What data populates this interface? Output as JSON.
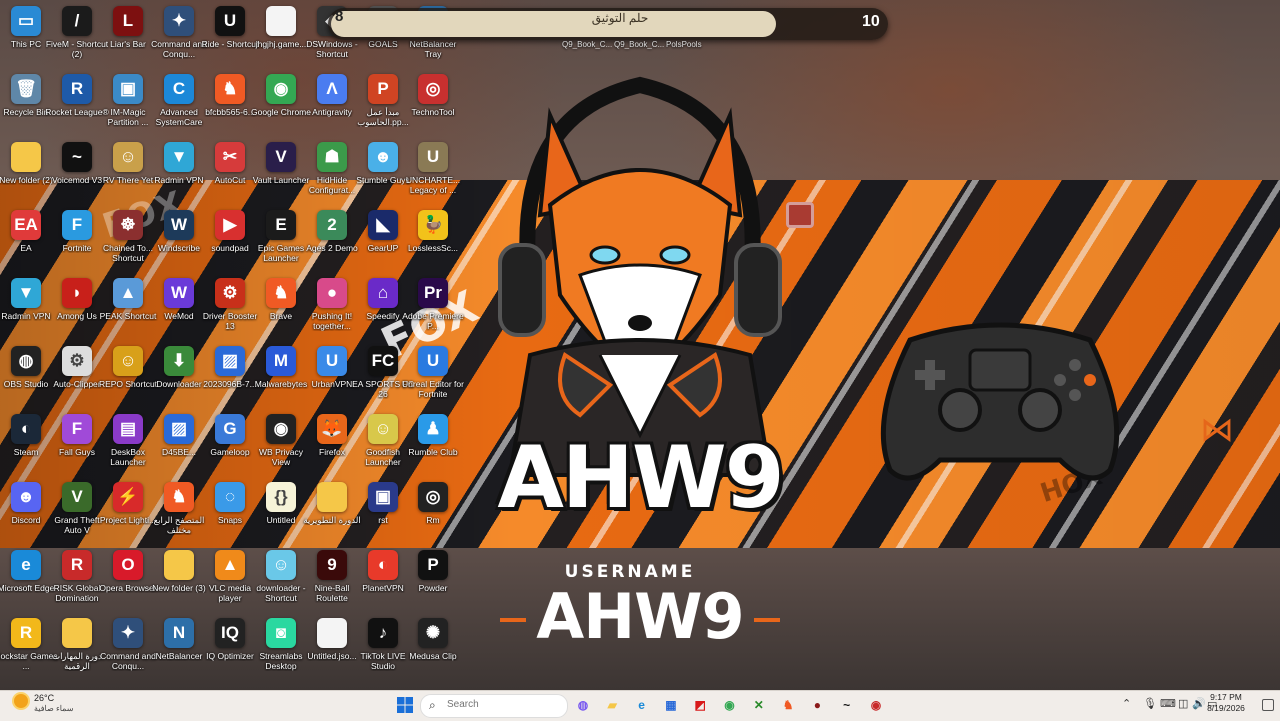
{
  "wallpaper": {
    "brand_text": "AHW9",
    "username_label": "USERNAME",
    "username_value": "AHW9",
    "watermark_left": "FOX",
    "watermark_mid": "FOX",
    "watermark_right": "HOX"
  },
  "widget": {
    "left_value": "8",
    "center_text": "حلم التوثيق",
    "right_value": "10",
    "sub_labels": [
      "Q9_Book_C...",
      "Q9_Book_C...",
      "PolsPools"
    ]
  },
  "desktop_icons": [
    {
      "label": "This PC",
      "icon": "computer-icon",
      "color": "#2a8ad4",
      "glyph": "▭"
    },
    {
      "label": "FiveM - Shortcut (2)",
      "icon": "fivem-icon",
      "color": "#1b1b1b",
      "glyph": "/"
    },
    {
      "label": "Liar's Bar",
      "icon": "liars-bar-icon",
      "color": "#7d1010",
      "glyph": "L"
    },
    {
      "label": "Command and Conqu...",
      "icon": "command-conquer-icon",
      "color": "#2f4f7a",
      "glyph": "✦"
    },
    {
      "label": "Ride - Shortcut",
      "icon": "unreal-icon",
      "color": "#111111",
      "glyph": "U"
    },
    {
      "label": "jhgjhj.game...",
      "icon": "file-icon",
      "color": "#f4f4f4",
      "glyph": ""
    },
    {
      "label": "DSWindows - Shortcut",
      "icon": "dswindows-icon",
      "color": "#333",
      "glyph": "◆"
    },
    {
      "label": "GOALS",
      "icon": "goals-icon",
      "color": "#555",
      "glyph": "G"
    },
    {
      "label": "NetBalancer Tray",
      "icon": "netbalancer-icon",
      "color": "#2d6fa8",
      "glyph": "N"
    },
    {
      "label": "Recycle Bin",
      "icon": "recycle-bin-icon",
      "color": "#5f87a8",
      "glyph": "🗑"
    },
    {
      "label": "Rocket League®",
      "icon": "rocket-league-icon",
      "color": "#1e5aa8",
      "glyph": "R"
    },
    {
      "label": "IM-Magic Partition ...",
      "icon": "partition-icon",
      "color": "#3b8ac7",
      "glyph": "▣"
    },
    {
      "label": "Advanced SystemCare",
      "icon": "systemcare-icon",
      "color": "#1c88d8",
      "glyph": "C"
    },
    {
      "label": "bfcbb565-6...",
      "icon": "brave-icon",
      "color": "#f05a24",
      "glyph": "♞"
    },
    {
      "label": "Google Chrome",
      "icon": "chrome-icon",
      "color": "#34a853",
      "glyph": "◉"
    },
    {
      "label": "Antigravity",
      "icon": "antigravity-icon",
      "color": "#4a7cf0",
      "glyph": "Λ"
    },
    {
      "label": "مبدأ عمل الحاسوب.pp...",
      "icon": "powerpoint-icon",
      "color": "#d04423",
      "glyph": "P"
    },
    {
      "label": "TechnoTool",
      "icon": "technotool-icon",
      "color": "#c8302f",
      "glyph": "◎"
    },
    {
      "label": "New folder (2)",
      "icon": "folder-icon",
      "color": "#f5c748",
      "glyph": ""
    },
    {
      "label": "Voicemod V3",
      "icon": "voicemod-icon",
      "color": "#111",
      "glyph": "~"
    },
    {
      "label": "RV There Yet",
      "icon": "rv-icon",
      "color": "#c9a04a",
      "glyph": "☺"
    },
    {
      "label": "Radmin VPN",
      "icon": "radmin-vpn-icon",
      "color": "#2fa7d6",
      "glyph": "▼"
    },
    {
      "label": "AutoCut",
      "icon": "autocut-icon",
      "color": "#d63b3b",
      "glyph": "✂"
    },
    {
      "label": "Vault Launcher",
      "icon": "vault-launcher-icon",
      "color": "#2a1e4a",
      "glyph": "V"
    },
    {
      "label": "HidHide Configurat...",
      "icon": "hidhide-icon",
      "color": "#3b9a4a",
      "glyph": "☗"
    },
    {
      "label": "Stumble Guys",
      "icon": "stumble-guys-icon",
      "color": "#4ab0e8",
      "glyph": "☻"
    },
    {
      "label": "UNCHARTE... Legacy of ...",
      "icon": "uncharted-icon",
      "color": "#8a7a55",
      "glyph": "U"
    },
    {
      "label": "EA",
      "icon": "ea-icon",
      "color": "#e03a3a",
      "glyph": "EA"
    },
    {
      "label": "Fortnite",
      "icon": "fortnite-icon",
      "color": "#2a9ae0",
      "glyph": "F"
    },
    {
      "label": "Chained To... Shortcut",
      "icon": "chained-icon",
      "color": "#8b2f2f",
      "glyph": "☸"
    },
    {
      "label": "Windscribe",
      "icon": "windscribe-icon",
      "color": "#1d3a5a",
      "glyph": "W"
    },
    {
      "label": "soundpad",
      "icon": "soundpad-icon",
      "color": "#d8302f",
      "glyph": "▶"
    },
    {
      "label": "Epic Games Launcher",
      "icon": "epic-games-icon",
      "color": "#1b1b1b",
      "glyph": "E"
    },
    {
      "label": "Ages 2 Demo",
      "icon": "ages-icon",
      "color": "#3b8a5a",
      "glyph": "2"
    },
    {
      "label": "GearUP",
      "icon": "gearup-icon",
      "color": "#1a2a6a",
      "glyph": "◣"
    },
    {
      "label": "LosslessSc...",
      "icon": "lossless-icon",
      "color": "#f2c21a",
      "glyph": "🦆"
    },
    {
      "label": "Radmin VPN",
      "icon": "radmin-vpn-icon",
      "color": "#2fa7d6",
      "glyph": "▼"
    },
    {
      "label": "Among Us",
      "icon": "among-us-icon",
      "color": "#c8201a",
      "glyph": "◗"
    },
    {
      "label": "PEAK Shortcut",
      "icon": "peak-icon",
      "color": "#5a9ad8",
      "glyph": "▲"
    },
    {
      "label": "WeMod",
      "icon": "wemod-icon",
      "color": "#6a3ad8",
      "glyph": "W"
    },
    {
      "label": "Driver Booster 13",
      "icon": "driver-booster-icon",
      "color": "#c8301a",
      "glyph": "⚙"
    },
    {
      "label": "Brave",
      "icon": "brave-icon",
      "color": "#f05a24",
      "glyph": "♞"
    },
    {
      "label": "Pushing It! together...",
      "icon": "pushing-icon",
      "color": "#d84a8a",
      "glyph": "●"
    },
    {
      "label": "Speedify",
      "icon": "speedify-icon",
      "color": "#6a2ac8",
      "glyph": "⌂"
    },
    {
      "label": "Adobe Premiere P...",
      "icon": "premiere-icon",
      "color": "#2a0a4a",
      "glyph": "Pr"
    },
    {
      "label": "OBS Studio",
      "icon": "obs-icon",
      "color": "#222",
      "glyph": "◍"
    },
    {
      "label": "Auto-Clipper",
      "icon": "auto-clipper-icon",
      "color": "#ddd",
      "glyph": "⚙"
    },
    {
      "label": "REPO Shortcut",
      "icon": "repo-icon",
      "color": "#d8a01a",
      "glyph": "☺"
    },
    {
      "label": "Downloader",
      "icon": "downloader-icon",
      "color": "#3a8a3a",
      "glyph": "⬇"
    },
    {
      "label": "2023096B-7...",
      "icon": "image-file-icon",
      "color": "#2a6ad8",
      "glyph": "▨"
    },
    {
      "label": "Malwarebytes",
      "icon": "malwarebytes-icon",
      "color": "#2a5ad8",
      "glyph": "M"
    },
    {
      "label": "UrbanVPN",
      "icon": "urbanvpn-icon",
      "color": "#3a8ae8",
      "glyph": "U"
    },
    {
      "label": "EA SPORTS FC 26",
      "icon": "fc26-icon",
      "color": "#111",
      "glyph": "FC"
    },
    {
      "label": "Unreal Editor for Fortnite",
      "icon": "unreal-editor-icon",
      "color": "#2a7ae0",
      "glyph": "U"
    },
    {
      "label": "Steam",
      "icon": "steam-icon",
      "color": "#1b2838",
      "glyph": "◐"
    },
    {
      "label": "Fall Guys",
      "icon": "fall-guys-icon",
      "color": "#a04ad8",
      "glyph": "F"
    },
    {
      "label": "DeskBox Launcher",
      "icon": "deskbox-icon",
      "color": "#8a3ac8",
      "glyph": "▤"
    },
    {
      "label": "D45BE...",
      "icon": "image-file-icon",
      "color": "#2a6ad8",
      "glyph": "▨"
    },
    {
      "label": "Gameloop",
      "icon": "gameloop-icon",
      "color": "#3a7ad8",
      "glyph": "G"
    },
    {
      "label": "WB Privacy View",
      "icon": "privacy-icon",
      "color": "#222",
      "glyph": "◉"
    },
    {
      "label": "Firefox",
      "icon": "firefox-icon",
      "color": "#e8661a",
      "glyph": "🦊"
    },
    {
      "label": "Goodfish Launcher",
      "icon": "goodfish-icon",
      "color": "#d8c84a",
      "glyph": "☺"
    },
    {
      "label": "Rumble Club",
      "icon": "rumble-club-icon",
      "color": "#2a9ae8",
      "glyph": "♟"
    },
    {
      "label": "Discord",
      "icon": "discord-icon",
      "color": "#5865f2",
      "glyph": "☻"
    },
    {
      "label": "Grand Theft Auto V",
      "icon": "gta5-icon",
      "color": "#3a6a2a",
      "glyph": "V"
    },
    {
      "label": "Project Lighti...",
      "icon": "project-icon",
      "color": "#d82a2a",
      "glyph": "⚡"
    },
    {
      "label": "المتصفح الرابع مختلف",
      "icon": "browser-icon",
      "color": "#f05a24",
      "glyph": "♞"
    },
    {
      "label": "Snaps",
      "icon": "snaps-icon",
      "color": "#3a9ae8",
      "glyph": "◌"
    },
    {
      "label": "Untitled",
      "icon": "code-file-icon",
      "color": "#f6f3d8",
      "glyph": "{}"
    },
    {
      "label": "الدورة التطويرية",
      "icon": "folder-icon",
      "color": "#f5c748",
      "glyph": ""
    },
    {
      "label": "rst",
      "icon": "rst-icon",
      "color": "#2a3a8a",
      "glyph": "▣"
    },
    {
      "label": "Rm",
      "icon": "rm-icon",
      "color": "#222",
      "glyph": "◎"
    },
    {
      "label": "Microsoft Edge",
      "icon": "edge-icon",
      "color": "#1a8ad8",
      "glyph": "e"
    },
    {
      "label": "RISK Global Domination",
      "icon": "risk-icon",
      "color": "#c82a2a",
      "glyph": "R"
    },
    {
      "label": "Opera Browser",
      "icon": "opera-icon",
      "color": "#d81a2a",
      "glyph": "O"
    },
    {
      "label": "New folder (3)",
      "icon": "folder-icon",
      "color": "#f5c748",
      "glyph": ""
    },
    {
      "label": "VLC media player",
      "icon": "vlc-icon",
      "color": "#f08a1a",
      "glyph": "▲"
    },
    {
      "label": "downloader - Shortcut",
      "icon": "downloader-anime-icon",
      "color": "#6ac8e8",
      "glyph": "☺"
    },
    {
      "label": "Nine-Ball Roulette",
      "icon": "nine-ball-icon",
      "color": "#3a0a0a",
      "glyph": "9"
    },
    {
      "label": "PlanetVPN",
      "icon": "planetvpn-icon",
      "color": "#e83a2a",
      "glyph": "◐"
    },
    {
      "label": "Powder",
      "icon": "powder-icon",
      "color": "#111",
      "glyph": "P"
    },
    {
      "label": "Rockstar Games ...",
      "icon": "rockstar-icon",
      "color": "#f2b81a",
      "glyph": "R"
    },
    {
      "label": "دورة المهارات الرقمية",
      "icon": "folder-icon",
      "color": "#f5c748",
      "glyph": ""
    },
    {
      "label": "Command and Conqu...",
      "icon": "command-conquer-icon",
      "color": "#2f4f7a",
      "glyph": "✦"
    },
    {
      "label": "NetBalancer",
      "icon": "netbalancer-icon",
      "color": "#2d6fa8",
      "glyph": "N"
    },
    {
      "label": "IQ Optimizer",
      "icon": "iq-optimizer-icon",
      "color": "#222",
      "glyph": "IQ"
    },
    {
      "label": "Streamlabs Desktop",
      "icon": "streamlabs-icon",
      "color": "#2ad8a0",
      "glyph": "◙"
    },
    {
      "label": "Untitled.jso...",
      "icon": "json-file-icon",
      "color": "#f4f4f4",
      "glyph": ""
    },
    {
      "label": "TikTok LIVE Studio",
      "icon": "tiktok-icon",
      "color": "#111",
      "glyph": "♪"
    },
    {
      "label": "Medusa Clip",
      "icon": "medusa-icon",
      "color": "#222",
      "glyph": "✺"
    }
  ],
  "taskbar": {
    "weather_temp": "26°C",
    "weather_desc": "سماء صافية",
    "search_placeholder": "Search",
    "clock_time": "9:17 PM",
    "clock_date": "8/19/2026",
    "pinned": [
      {
        "name": "copilot-icon",
        "color": "#7a5af0",
        "glyph": "◍"
      },
      {
        "name": "file-explorer-icon",
        "color": "#f5c748",
        "glyph": "▰"
      },
      {
        "name": "edge-icon",
        "color": "#1a8ad8",
        "glyph": "e"
      },
      {
        "name": "store-icon",
        "color": "#2a6ad8",
        "glyph": "▦"
      },
      {
        "name": "amd-icon",
        "color": "#d81a1a",
        "glyph": "◩"
      },
      {
        "name": "chrome-icon",
        "color": "#34a853",
        "glyph": "◉"
      },
      {
        "name": "xbox-icon",
        "color": "#2a8a2a",
        "glyph": "✕"
      },
      {
        "name": "brave-icon",
        "color": "#f05a24",
        "glyph": "♞"
      },
      {
        "name": "app-icon",
        "color": "#8a1a1a",
        "glyph": "●"
      },
      {
        "name": "voicemod-icon",
        "color": "#111",
        "glyph": "~"
      },
      {
        "name": "app-alert-icon",
        "color": "#c82a2a",
        "glyph": "◉"
      }
    ]
  }
}
